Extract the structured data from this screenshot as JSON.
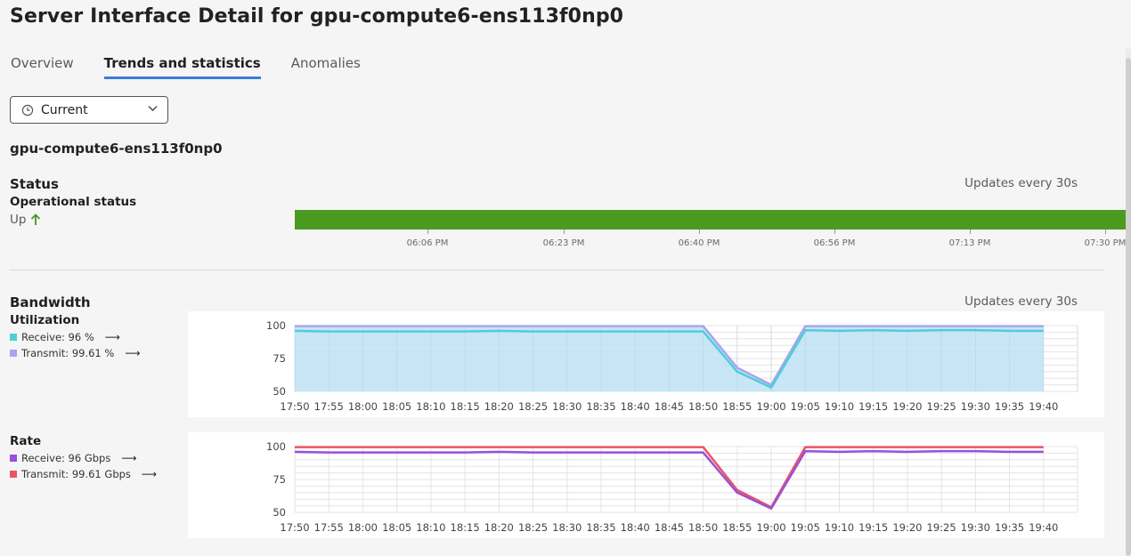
{
  "page": {
    "title": "Server Interface Detail for gpu-compute6-ens113f0np0"
  },
  "tabs": [
    {
      "label": "Overview",
      "active": false
    },
    {
      "label": "Trends and statistics",
      "active": true
    },
    {
      "label": "Anomalies",
      "active": false
    }
  ],
  "time_selector": {
    "value": "Current",
    "icon": "clock-icon"
  },
  "interface_name": "gpu-compute6-ens113f0np0",
  "status": {
    "heading": "Status",
    "updates": "Updates every 30s",
    "operational_label": "Operational status",
    "value": "Up",
    "color": "#4a9a1f",
    "time_ticks": [
      "06:06 PM",
      "06:23 PM",
      "06:40 PM",
      "06:56 PM",
      "07:13 PM",
      "07:30 PM"
    ]
  },
  "bandwidth": {
    "heading": "Bandwidth",
    "updates": "Updates every 30s",
    "utilization": {
      "label": "Utilization",
      "receive_label": "Receive: 96 %",
      "transmit_label": "Transmit: 99.61 %",
      "receive_color": "#4dcfd6",
      "transmit_color": "#a9a4ee"
    },
    "rate": {
      "label": "Rate",
      "receive_label": "Receive: 96 Gbps",
      "transmit_label": "Transmit: 99.61 Gbps",
      "receive_color": "#9b4fdb",
      "transmit_color": "#e85561"
    }
  },
  "chart_data": [
    {
      "type": "area",
      "title": "Utilization",
      "ylim": [
        50,
        100
      ],
      "yticks": [
        100,
        75,
        50
      ],
      "x": [
        "17:50",
        "17:55",
        "18:00",
        "18:05",
        "18:10",
        "18:15",
        "18:20",
        "18:25",
        "18:30",
        "18:35",
        "18:40",
        "18:45",
        "18:50",
        "18:55",
        "19:00",
        "19:05",
        "19:10",
        "19:15",
        "19:20",
        "19:25",
        "19:30",
        "19:35",
        "19:40"
      ],
      "series": [
        {
          "name": "Receive",
          "color": "#4dcfd6",
          "values": [
            96,
            95.5,
            95.5,
            95.5,
            95.5,
            95.5,
            96,
            95.5,
            95.5,
            95.5,
            95.5,
            95.5,
            95.5,
            65,
            53,
            96.5,
            96,
            96.5,
            96,
            96.5,
            96.5,
            96,
            96
          ]
        },
        {
          "name": "Transmit",
          "color": "#a9a4ee",
          "values": [
            99.61,
            99.61,
            99.61,
            99.61,
            99.61,
            99.61,
            99.61,
            99.61,
            99.61,
            99.61,
            99.61,
            99.61,
            99.61,
            68,
            55,
            99.61,
            99.61,
            99.61,
            99.61,
            99.61,
            99.61,
            99.61,
            99.61
          ]
        }
      ],
      "grid": true
    },
    {
      "type": "line",
      "title": "Rate",
      "ylim": [
        50,
        100
      ],
      "yticks": [
        100,
        75,
        50
      ],
      "x": [
        "17:50",
        "17:55",
        "18:00",
        "18:05",
        "18:10",
        "18:15",
        "18:20",
        "18:25",
        "18:30",
        "18:35",
        "18:40",
        "18:45",
        "18:50",
        "18:55",
        "19:00",
        "19:05",
        "19:10",
        "19:15",
        "19:20",
        "19:25",
        "19:30",
        "19:35",
        "19:40"
      ],
      "series": [
        {
          "name": "Receive",
          "color": "#9b4fdb",
          "values": [
            96,
            95.5,
            95.5,
            95.5,
            95.5,
            95.5,
            96,
            95.5,
            95.5,
            95.5,
            95.5,
            95.5,
            95.5,
            65,
            53,
            96.5,
            96,
            96.5,
            96,
            96.5,
            96.5,
            96,
            96
          ]
        },
        {
          "name": "Transmit",
          "color": "#e85561",
          "values": [
            99.61,
            99.61,
            99.61,
            99.61,
            99.61,
            99.61,
            99.61,
            99.61,
            99.61,
            99.61,
            99.61,
            99.61,
            99.61,
            67,
            54,
            99.61,
            99.61,
            99.61,
            99.61,
            99.61,
            99.61,
            99.61,
            99.61
          ]
        }
      ],
      "grid": true
    }
  ]
}
